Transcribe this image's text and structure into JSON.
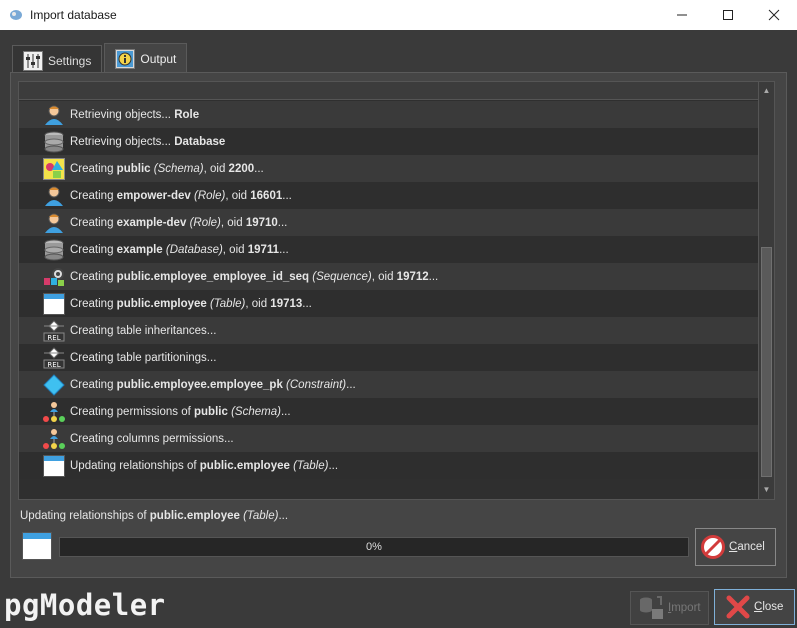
{
  "window": {
    "title": "Import database",
    "minimize_glyph": "—",
    "maximize_glyph": "☐",
    "close_glyph": "✕",
    "app_icon": "pgmodeler-icon"
  },
  "tabs": [
    {
      "label": "Settings",
      "icon": "settings-sliders-icon",
      "active": false
    },
    {
      "label": "Output",
      "icon": "info-icon",
      "active": true
    }
  ],
  "output_rows": [
    {
      "icon": "role-icon",
      "pre": "Retrieving objects... ",
      "bold": "Role",
      "italic": "",
      "mid": "",
      "bold2": "",
      "post": ""
    },
    {
      "icon": "database-icon",
      "pre": "Retrieving objects... ",
      "bold": "Database",
      "italic": "",
      "mid": "",
      "bold2": "",
      "post": ""
    },
    {
      "icon": "schema-icon",
      "pre": "Creating ",
      "bold": "public",
      "italic": "(Schema)",
      "mid": ", oid ",
      "bold2": "2200",
      "post": "..."
    },
    {
      "icon": "role-icon",
      "pre": "Creating ",
      "bold": "empower-dev",
      "italic": "(Role)",
      "mid": ", oid ",
      "bold2": "16601",
      "post": "..."
    },
    {
      "icon": "role-icon",
      "pre": "Creating ",
      "bold": "example-dev",
      "italic": "(Role)",
      "mid": ", oid ",
      "bold2": "19710",
      "post": "..."
    },
    {
      "icon": "database-icon",
      "pre": "Creating ",
      "bold": "example",
      "italic": "(Database)",
      "mid": ", oid ",
      "bold2": "19711",
      "post": "..."
    },
    {
      "icon": "sequence-icon",
      "pre": "Creating ",
      "bold": "public.employee_employee_id_seq",
      "italic": "(Sequence)",
      "mid": ", oid ",
      "bold2": "19712",
      "post": "..."
    },
    {
      "icon": "table-icon",
      "pre": "Creating ",
      "bold": "public.employee",
      "italic": "(Table)",
      "mid": ", oid ",
      "bold2": "19713",
      "post": "..."
    },
    {
      "icon": "relationship-icon",
      "pre": "Creating table inheritances...",
      "bold": "",
      "italic": "",
      "mid": "",
      "bold2": "",
      "post": ""
    },
    {
      "icon": "relationship-icon",
      "pre": "Creating table partitionings...",
      "bold": "",
      "italic": "",
      "mid": "",
      "bold2": "",
      "post": ""
    },
    {
      "icon": "constraint-icon",
      "pre": "Creating ",
      "bold": "public.employee.employee_pk",
      "italic": "(Constraint)",
      "mid": "",
      "bold2": "",
      "post": "..."
    },
    {
      "icon": "permission-icon",
      "pre": "Creating permissions of ",
      "bold": "public",
      "italic": "(Schema)",
      "mid": "",
      "bold2": "",
      "post": "..."
    },
    {
      "icon": "permission-icon",
      "pre": "Creating columns permissions...",
      "bold": "",
      "italic": "",
      "mid": "",
      "bold2": "",
      "post": ""
    },
    {
      "icon": "table-icon",
      "pre": "Updating relationships of ",
      "bold": "public.employee",
      "italic": "(Table)",
      "mid": "",
      "bold2": "",
      "post": "..."
    }
  ],
  "status": {
    "pre": "Updating relationships of ",
    "bold": "public.employee",
    "italic": "(Table)",
    "post": "...",
    "icon": "table-icon"
  },
  "progress": {
    "value": 0,
    "label": "0%"
  },
  "buttons": {
    "cancel": {
      "u": "C",
      "rest": "ancel",
      "icon": "cancel-icon"
    },
    "import": {
      "u": "I",
      "rest": "mport",
      "icon": "import-icon",
      "enabled": false
    },
    "close": {
      "u": "C",
      "rest": "lose",
      "icon": "close-x-icon"
    }
  },
  "brand": {
    "logo_text": "pgModeler"
  },
  "colors": {
    "accent": "#7fb0d8",
    "background": "#3a3a3a",
    "list_bg": "#2f2f2f"
  }
}
